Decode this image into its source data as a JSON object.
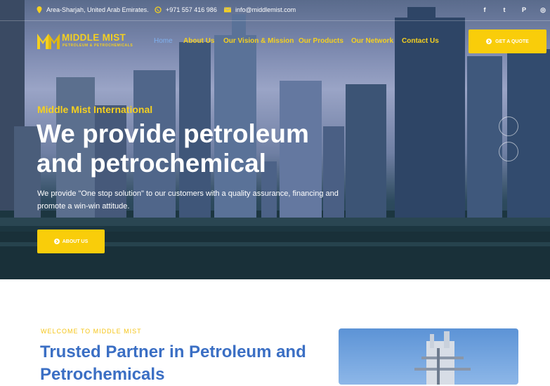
{
  "topbar": {
    "address": "Area-Sharjah, United Arab Emirates.",
    "phone": "+971 557 416 986",
    "email": "info@middlemist.com",
    "social": [
      {
        "icon": "facebook-icon",
        "glyph": "f"
      },
      {
        "icon": "twitter-icon",
        "glyph": "t"
      },
      {
        "icon": "pinterest-icon",
        "glyph": "P"
      },
      {
        "icon": "instagram-icon",
        "glyph": "◎"
      }
    ]
  },
  "logo": {
    "name": "MIDDLE MIST",
    "tagline": "PETROLEUM & PETROCHEMICALS"
  },
  "nav": [
    {
      "label": "Home",
      "active": true
    },
    {
      "label": "About Us"
    },
    {
      "label": "Our Vision & Mission"
    },
    {
      "label": "Our Products"
    },
    {
      "label": "Our Network"
    },
    {
      "label": "Contact Us"
    }
  ],
  "quote_button": "GET A QUOTE",
  "hero": {
    "eyebrow": "Middle Mist International",
    "headline": "We provide petroleum and petrochemical",
    "description": "We provide \"One stop solution\" to our customers with a quality assurance, financing and promote a win-win attitude.",
    "button": "ABOUT US"
  },
  "intro": {
    "eyebrow": "WELCOME TO MIDDLE MIST",
    "title": "Trusted Partner in Petroleum and Petrochemicals"
  },
  "colors": {
    "accent": "#f9cd0a",
    "brand_blue": "#3b6fc4"
  }
}
